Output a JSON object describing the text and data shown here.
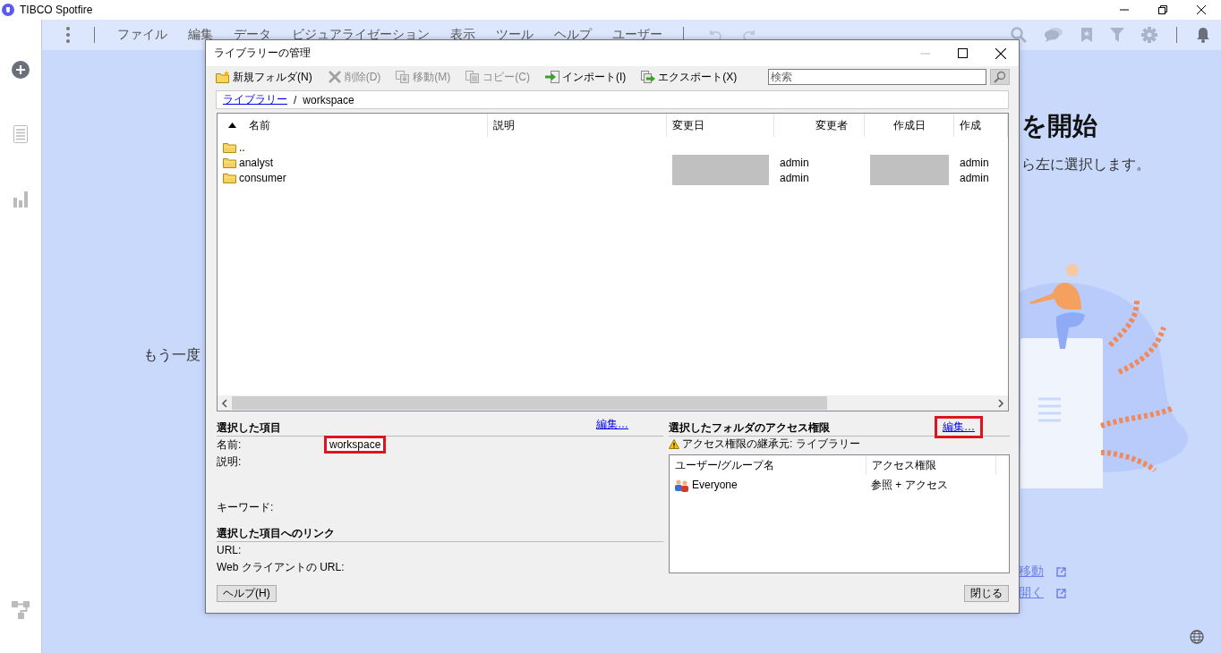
{
  "app": {
    "title": "TIBCO Spotfire"
  },
  "menu": [
    "ファイル",
    "編集",
    "データ",
    "ビジュアライゼーション",
    "表示",
    "ツール",
    "ヘルプ",
    "ユーザー"
  ],
  "background": {
    "heading": "を開始",
    "subtitle": "ら左に選択します。",
    "prompt": "もう一度",
    "links": [
      "移動",
      "開く"
    ]
  },
  "dialog": {
    "title": "ライブラリーの管理",
    "toolbar": [
      {
        "kind": "new-folder",
        "label": "新規フォルダ(N)",
        "disabled": false
      },
      {
        "kind": "delete",
        "label": "削除(D)",
        "disabled": true
      },
      {
        "kind": "move",
        "label": "移動(M)",
        "disabled": true
      },
      {
        "kind": "copy",
        "label": "コピー(C)",
        "disabled": true
      },
      {
        "kind": "import",
        "label": "インポート(I)",
        "disabled": false
      },
      {
        "kind": "export",
        "label": "エクスポート(X)",
        "disabled": false
      }
    ],
    "search": {
      "placeholder": "検索"
    },
    "breadcrumb": {
      "root": "ライブラリー",
      "separator": "/",
      "current": "workspace"
    },
    "table": {
      "sort_ascending": true,
      "columns": [
        "名前",
        "説明",
        "変更日",
        "変更者",
        "作成日",
        "作成"
      ],
      "rows": [
        {
          "name": ".."
        },
        {
          "name": "analyst",
          "modified_redacted": true,
          "modified_by": "admin",
          "created_redacted": true,
          "created_by": "admin"
        },
        {
          "name": "consumer",
          "modified_redacted": true,
          "modified_by": "admin",
          "created_redacted": true,
          "created_by": "admin"
        }
      ]
    },
    "selected_item": {
      "heading": "選択した項目",
      "edit_link": {
        "label": "編集…",
        "highlighted": false
      },
      "fields": [
        {
          "label": "名前:",
          "value": "workspace",
          "highlighted": true
        },
        {
          "label": "説明:"
        },
        {
          "label": "キーワード:"
        }
      ]
    },
    "link_section": {
      "heading": "選択した項目へのリンク",
      "fields": [
        {
          "label": "URL:"
        },
        {
          "label": "Web クライアントの URL:"
        }
      ]
    },
    "permissions": {
      "heading": "選択したフォルダのアクセス権限",
      "edit_link": {
        "label": "編集…",
        "highlighted": true
      },
      "inherit_note": "アクセス権限の継承元: ライブラリー",
      "columns": [
        "ユーザー/グループ名",
        "アクセス権限"
      ],
      "rows": [
        {
          "name": "Everyone",
          "access": "参照 + アクセス"
        }
      ]
    },
    "buttons": [
      {
        "kind": "help",
        "label": "ヘルプ(H)"
      },
      {
        "kind": "close",
        "label": "閉じる"
      }
    ]
  }
}
